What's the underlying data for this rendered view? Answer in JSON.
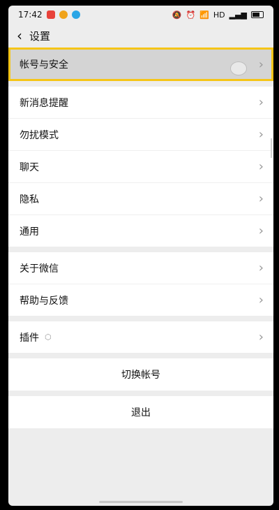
{
  "status_bar": {
    "time": "17:42",
    "network_label": "HD"
  },
  "header": {
    "title": "设置"
  },
  "groups": [
    {
      "items": [
        {
          "label": "帐号与安全"
        }
      ]
    },
    {
      "items": [
        {
          "label": "新消息提醒"
        },
        {
          "label": "勿扰模式"
        },
        {
          "label": "聊天"
        },
        {
          "label": "隐私"
        },
        {
          "label": "通用"
        }
      ]
    },
    {
      "items": [
        {
          "label": "关于微信"
        },
        {
          "label": "帮助与反馈"
        }
      ]
    },
    {
      "items": [
        {
          "label": "插件"
        }
      ]
    }
  ],
  "actions": {
    "switch_account": "切换帐号",
    "logout": "退出"
  },
  "colors": {
    "highlight_border": "#f5c518",
    "background": "#ededed"
  }
}
